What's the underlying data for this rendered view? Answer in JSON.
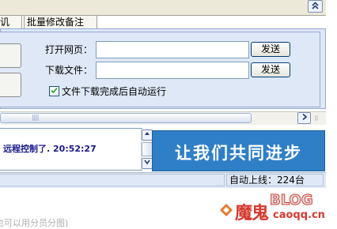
{
  "tabs": {
    "partial_tab_label": "讥",
    "batch_note_tab_label": "批量修改备注"
  },
  "form": {
    "open_url_label": "打开网页：",
    "open_url_value": "",
    "download_label": "下载文件：",
    "download_value": "",
    "send_label": "发送",
    "auto_run_label": "文件下载完成后自动运行",
    "auto_run_checked": true
  },
  "log": {
    "line": "远程控制了. 20:52:27"
  },
  "banner": {
    "text": "让我们共同进步"
  },
  "status": {
    "online_text": "自动上线：224台"
  },
  "bottom": {
    "clipped_text": "也可以用分员分图)"
  },
  "watermark": {
    "main": "魔鬼",
    "blog": "BLOG",
    "domain": "caoqq.cn"
  },
  "icons": {
    "scroll_up": "double-chevron-up-icon",
    "scroll_right": "chevron-right-icon",
    "scroll_v_up": "triangle-up-icon",
    "scroll_v_down": "chevron-down-icon",
    "check": "checkmark-icon"
  },
  "colors": {
    "panel_bg": "#dfe8f6",
    "banner_bg": "#2f7fc7",
    "log_text": "#1a1a8c",
    "watermark_red": "#d43a2f"
  }
}
